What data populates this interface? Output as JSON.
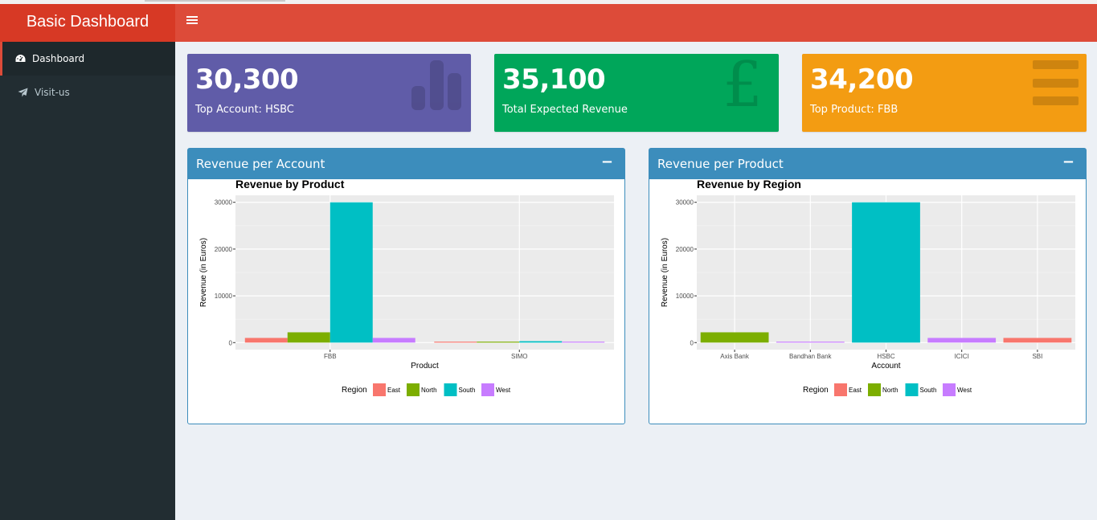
{
  "header": {
    "title": "Basic Dashboard",
    "toggle_icon": "hamburger-icon"
  },
  "sidebar": {
    "items": [
      {
        "label": "Dashboard",
        "icon": "dashboard-icon",
        "active": true
      },
      {
        "label": "Visit-us",
        "icon": "paper-plane-icon",
        "active": false
      }
    ]
  },
  "info_boxes": [
    {
      "value": "30,300",
      "subtitle": "Top Account: HSBC",
      "icon": "bar-chart-icon",
      "color": "#605ca8"
    },
    {
      "value": "35,100",
      "subtitle": "Total Expected Revenue",
      "icon": "pound-icon",
      "color": "#00a65a"
    },
    {
      "value": "34,200",
      "subtitle": "Top Product: FBB",
      "icon": "list-icon",
      "color": "#f39c12"
    }
  ],
  "boxes": [
    {
      "title": "Revenue per Account",
      "collapse": "−"
    },
    {
      "title": "Revenue per Product",
      "collapse": "−"
    }
  ],
  "chart_data": [
    {
      "type": "bar",
      "title": "Revenue by Product",
      "xlabel": "Product",
      "ylabel": "Revenue (in Euros)",
      "categories": [
        "FBB",
        "SIMO"
      ],
      "ylim": [
        -1500,
        31500
      ],
      "yticks": [
        0,
        10000,
        20000,
        30000
      ],
      "legend": {
        "title": "Region",
        "position": "bottom"
      },
      "series": [
        {
          "name": "East",
          "color": "#F8766D",
          "values": [
            1000,
            200
          ]
        },
        {
          "name": "North",
          "color": "#7CAE00",
          "values": [
            2200,
            200
          ]
        },
        {
          "name": "South",
          "color": "#00BFC4",
          "values": [
            30000,
            300
          ]
        },
        {
          "name": "West",
          "color": "#C77CFF",
          "values": [
            1000,
            200
          ]
        }
      ],
      "grid": true
    },
    {
      "type": "bar",
      "title": "Revenue by Region",
      "xlabel": "Account",
      "ylabel": "Revenue (in Euros)",
      "categories": [
        "Axis Bank",
        "Bandhan Bank",
        "HSBC",
        "ICICI",
        "SBI"
      ],
      "ylim": [
        -1500,
        31500
      ],
      "yticks": [
        0,
        10000,
        20000,
        30000
      ],
      "legend": {
        "title": "Region",
        "position": "bottom"
      },
      "bars": [
        {
          "category": "Axis Bank",
          "region": "North",
          "color": "#7CAE00",
          "value": 2200
        },
        {
          "category": "Bandhan Bank",
          "region": "West",
          "color": "#C77CFF",
          "value": 200
        },
        {
          "category": "HSBC",
          "region": "South",
          "color": "#00BFC4",
          "value": 30000
        },
        {
          "category": "ICICI",
          "region": "West",
          "color": "#C77CFF",
          "value": 1000
        },
        {
          "category": "SBI",
          "region": "East",
          "color": "#F8766D",
          "value": 1000
        }
      ],
      "legend_items": [
        {
          "name": "East",
          "color": "#F8766D"
        },
        {
          "name": "North",
          "color": "#7CAE00"
        },
        {
          "name": "South",
          "color": "#00BFC4"
        },
        {
          "name": "West",
          "color": "#C77CFF"
        }
      ],
      "grid": true
    }
  ]
}
